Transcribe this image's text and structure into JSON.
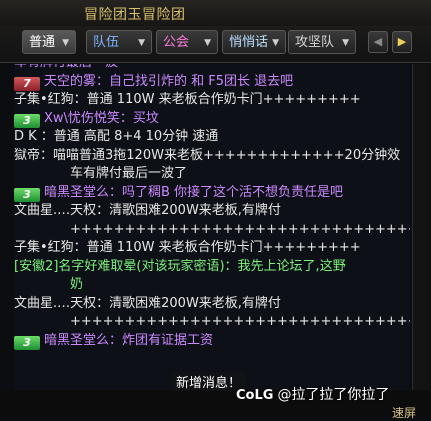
{
  "window": {
    "title": "冒险团玉冒险团"
  },
  "tabs": [
    {
      "label": "普通",
      "color": "#ffffff"
    },
    {
      "label": "队伍",
      "color": "#7fb4ff"
    },
    {
      "label": "公会",
      "color": "#ff7ad8"
    },
    {
      "label": "悄悄话",
      "color": "#b9e0ff"
    },
    {
      "label": "攻坚队",
      "color": "#d6d6d6"
    }
  ],
  "nav": {
    "prev": "◀",
    "next": "▶"
  },
  "chat": {
    "messages": [
      {
        "text": "车有牌付最后一波",
        "color": "#cc88ff"
      },
      {
        "badge": "7",
        "badge_color": "red",
        "text": "天空的雾：自己找引炸的 和 F5团长 退去吧",
        "color": "#cc88ff"
      },
      {
        "text": "子集•红狗：普通 110W 来老板合作奶卡门+++++++++",
        "color": "#e6e6e6"
      },
      {
        "badge": "3",
        "badge_color": "green",
        "text": "Xw\\忧伤悦笑：买坟",
        "color": "#cc88ff"
      },
      {
        "text": " D K  ：普通   高配   8+4   10分钟 速通",
        "color": "#e6e6e6"
      },
      {
        "text": "獄帝：喵喵普通3拖120W来老板+++++++++++++20分钟效",
        "color": "#e6e6e6"
      },
      {
        "text": "车有牌付最后一波了",
        "color": "#e6e6e6",
        "indent": true
      },
      {
        "badge": "3",
        "badge_color": "green",
        "text": "暗黑圣堂么：吗了稠B  你接了这个活不想负责任是吧",
        "color": "#cc88ff"
      },
      {
        "text": "文曲星.…天权：清歌困难200W来老板,有牌付",
        "color": "#e6e6e6"
      },
      {
        "text": "+++++++++++++++++++++++++++++++++++",
        "color": "#e6e6e6",
        "indent": true
      },
      {
        "text": "子集•红狗：普通 110W 来老板合作奶卡门+++++++++",
        "color": "#e6e6e6"
      },
      {
        "text": "[安徽2]名字好难取晕(对该玩家密语)：我先上论坛了,这野",
        "color": "#7df07d"
      },
      {
        "text": "奶",
        "color": "#7df07d",
        "indent": true
      },
      {
        "text": "文曲星.…天权：清歌困难200W来老板,有牌付",
        "color": "#e6e6e6"
      },
      {
        "text": "+++++++++++++++++++++++++++++++++++",
        "color": "#e6e6e6",
        "indent": true
      },
      {
        "badge": "3",
        "badge_color": "green",
        "text": "暗黑圣堂么：炸团有证据工资",
        "color": "#cc88ff"
      }
    ]
  },
  "toast": "新增消息！",
  "watermark": {
    "logo": "CoLG",
    "text": "@拉了拉了你拉了"
  },
  "footer": {
    "label": "速屏"
  }
}
